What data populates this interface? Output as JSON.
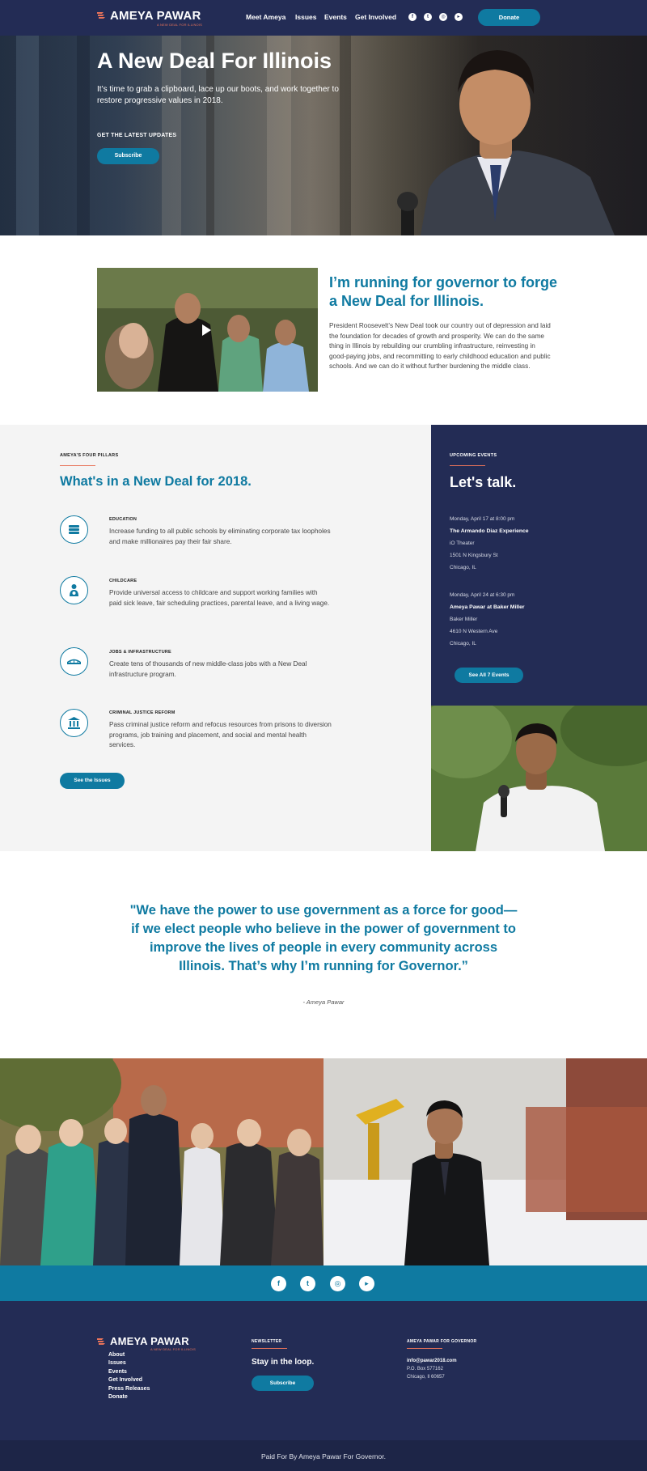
{
  "nav": {
    "logo_name": "AMEYA PAWAR",
    "logo_tagline": "A NEW DEAL FOR ILLINOIS",
    "links": [
      "Meet Ameya",
      "Issues",
      "Events",
      "Get Involved"
    ],
    "social_icons": [
      "facebook-icon",
      "twitter-icon",
      "instagram-icon",
      "youtube-icon"
    ],
    "donate": "Donate"
  },
  "hero": {
    "title": "A New Deal For Illinois",
    "subtitle": "It’s time to grab a clipboard, lace up our boots, and work together to restore progressive values in 2018.",
    "cta_label": "GET THE LATEST UPDATES",
    "cta_button": "Subscribe"
  },
  "intro": {
    "title": "I’m running for governor to forge a New Deal for Illinois.",
    "body": "President Roosevelt’s New Deal took our country out of depression and laid the foundation for decades of growth and prosperity. We can do the same thing in Illinois by rebuilding our crumbling infrastructure, reinvesting in good-paying jobs, and recommitting to early childhood education and public schools. And we can do it without further burdening the middle class."
  },
  "pillars": {
    "eyebrow": "AMEYA’S FOUR PILLARS",
    "title": "What's in a New Deal for 2018.",
    "items": [
      {
        "icon": "education-icon",
        "label": "EDUCATION",
        "text": "Increase funding to all public schools by eliminating corporate tax loopholes and make millionaires pay their fair share."
      },
      {
        "icon": "childcare-icon",
        "label": "CHILDCARE",
        "text": "Provide universal access to childcare and support working families with paid sick leave, fair scheduling practices, parental leave, and a living wage."
      },
      {
        "icon": "bridge-icon",
        "label": "JOBS & INFRASTRUCTURE",
        "text": "Create tens of thousands of new middle-class jobs with a New Deal infrastructure program."
      },
      {
        "icon": "courthouse-icon",
        "label": "CRIMINAL JUSTICE REFORM",
        "text": "Pass criminal justice reform and refocus resources from prisons to diversion programs, job training and placement, and social and mental health services."
      }
    ],
    "button": "See the Issues"
  },
  "events": {
    "eyebrow": "UPCOMING EVENTS",
    "title": "Let's talk.",
    "items": [
      {
        "date": "Monday, April 17 at 8:00 pm",
        "name": "The Armando Diaz Experience",
        "venue": "iO Theater",
        "address": "1501 N Kingsbury St",
        "city": "Chicago, IL"
      },
      {
        "date": "Monday, April 24 at 6:30 pm",
        "name": "Ameya Pawar at Baker Miller",
        "venue": "Baker Miller",
        "address": "4610 N Western Ave",
        "city": "Chicago, IL"
      }
    ],
    "button": "See All 7 Events"
  },
  "quote": {
    "text": "\"We have the power to use government as a force for good—if we elect people who believe in the power of government to improve the lives of people in every community across Illinois. That’s why I’m running for Governor.”",
    "attribution": "- Ameya Pawar"
  },
  "social_bar": {
    "icons": [
      "facebook-icon",
      "twitter-icon",
      "instagram-icon",
      "youtube-icon"
    ]
  },
  "footer": {
    "logo_name": "AMEYA PAWAR",
    "logo_tagline": "A NEW DEAL FOR ILLINOIS",
    "links": [
      "About",
      "Issues",
      "Events",
      "Get Involved",
      "Press Releases",
      "Donate"
    ],
    "newsletter_eyebrow": "NEWSLETTER",
    "newsletter_title": "Stay in the loop.",
    "newsletter_button": "Subscribe",
    "contact_eyebrow": "AMEYA PAWAR FOR GOVERNOR",
    "email": "info@pawar2018.com",
    "po_box": "P.O. Box 577162",
    "city": "Chicago, Il 60657"
  },
  "bottom_bar": {
    "text": "Paid For By Ameya Pawar For Governor."
  },
  "colors": {
    "navy": "#232c55",
    "teal": "#0f7aa1",
    "accent": "#e8735a",
    "light_gray": "#f4f4f4"
  }
}
